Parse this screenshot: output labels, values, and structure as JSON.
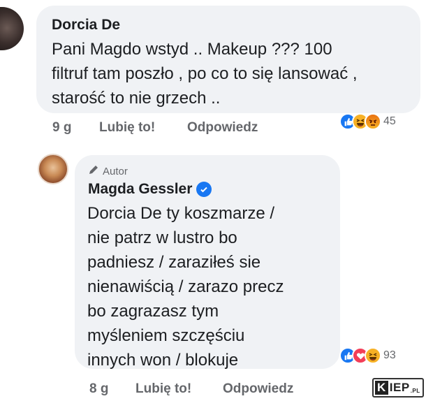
{
  "comment1": {
    "author": "Dorcia De",
    "text": "Pani Magdo wstyd .. Makeup ???  100\nfiltruf tam poszło , po co to się lansować ,\nstarość to nie grzech ..",
    "time": "9 g",
    "like_label": "Lubię to!",
    "reply_label": "Odpowiedz",
    "reactions": [
      "like-icon",
      "haha-icon",
      "angry-icon"
    ],
    "reaction_count": "45"
  },
  "comment2": {
    "badge": "Autor",
    "author": "Magda Gessler",
    "text": "Dorcia De ty  koszmarze /\nnie patrz w lustro bo\npadniesz / zaraziłeś sie\nnienawiścią / zarazo precz\nbo zagrazasz tym\nmyśleniem szczęściu\ninnych won / blokuje",
    "time": "8 g",
    "like_label": "Lubię to!",
    "reply_label": "Odpowiedz",
    "reactions": [
      "like-icon",
      "love-icon",
      "haha-icon"
    ],
    "reaction_count": "93"
  },
  "watermark": {
    "k": "K",
    "rest": "IEP",
    "suffix": ".PL"
  },
  "colors": {
    "bubble": "#f0f2f5",
    "meta": "#65676b",
    "like": "#1877f2",
    "love": "#f33e58",
    "haha": "#f7b125"
  }
}
